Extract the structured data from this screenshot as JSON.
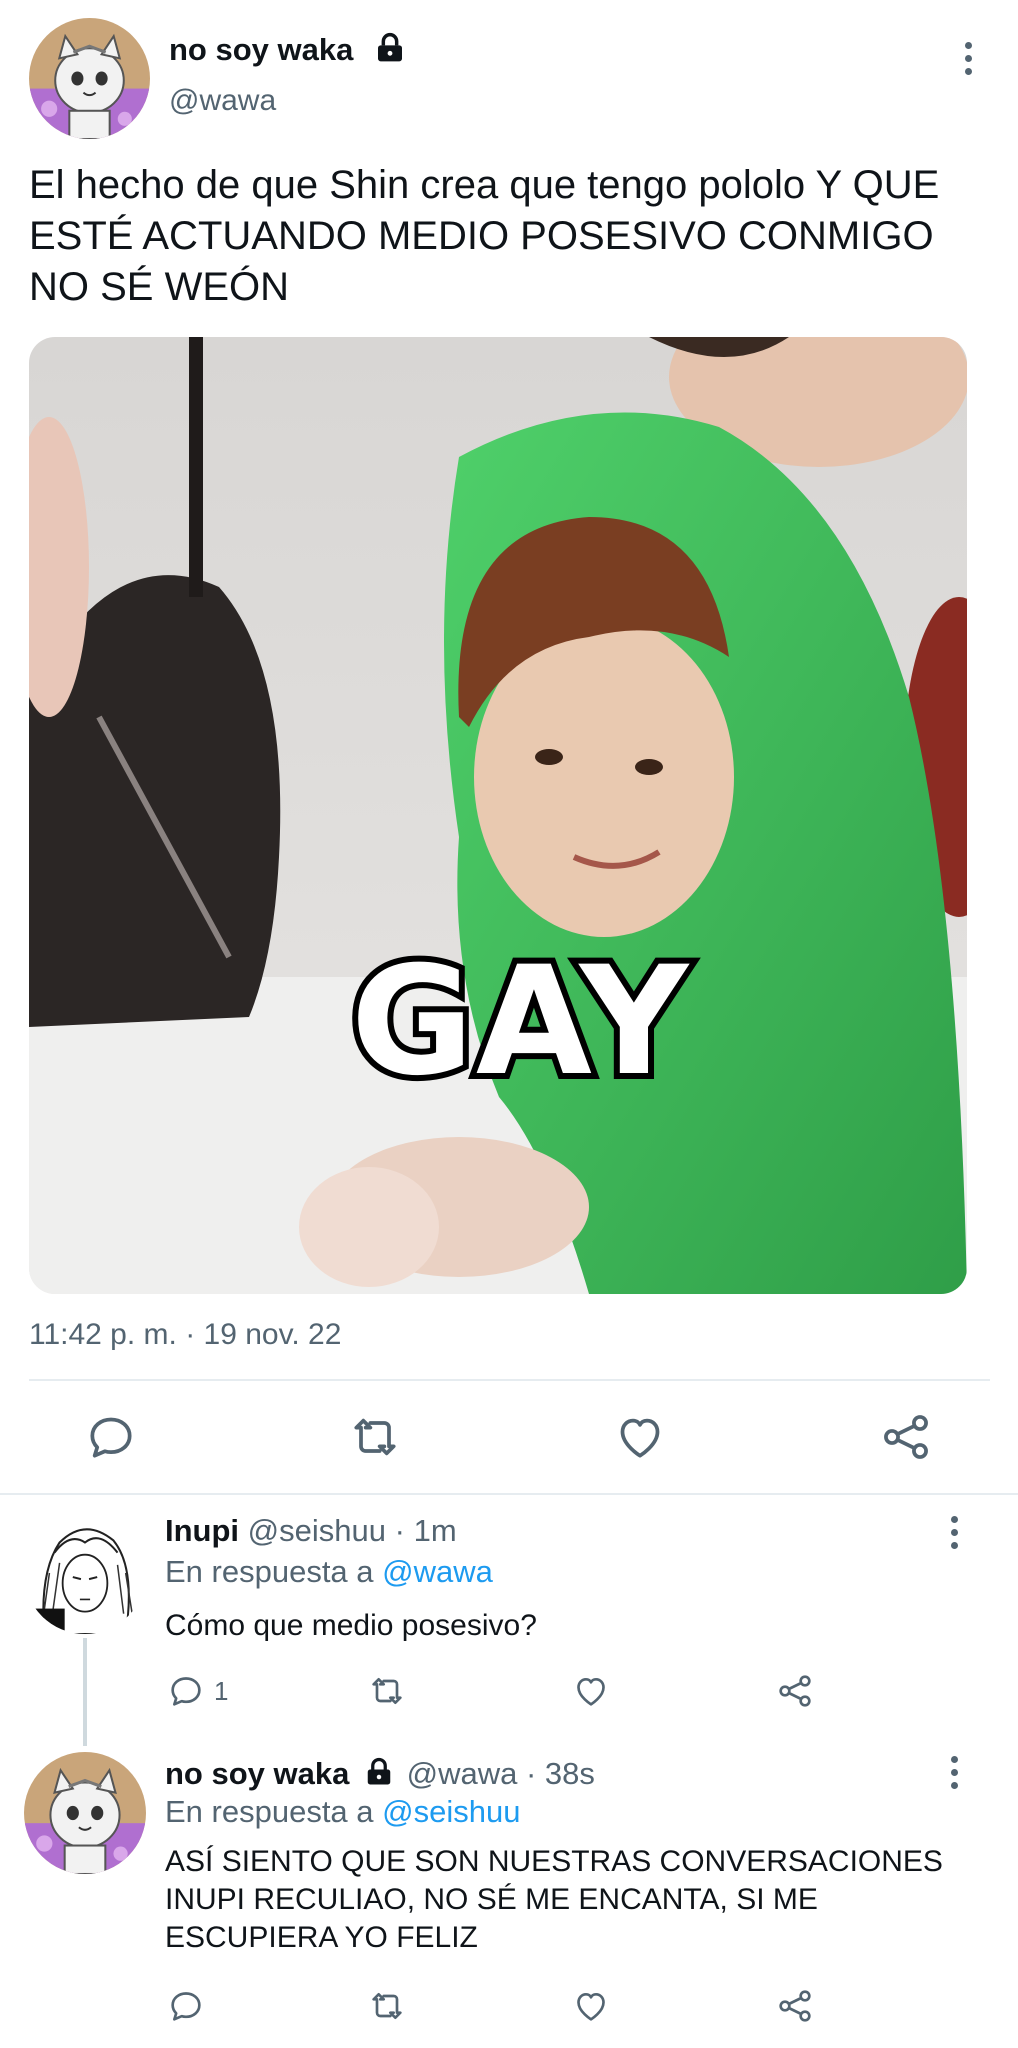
{
  "main_tweet": {
    "display_name": "no soy waka",
    "handle": "@wawa",
    "text": "El hecho de que Shin crea que tengo pololo Y QUE ESTÉ ACTUANDO MEDIO POSESIVO CONMIGO NO SÉ WEÓN",
    "media_caption": "GAY",
    "timestamp": "11:42 p. m. · 19 nov. 22",
    "icons": {
      "lock": "lock-icon",
      "more": "more-vertical-icon"
    }
  },
  "action_bar": {
    "icons": [
      "reply-icon",
      "retweet-icon",
      "like-icon",
      "share-icon"
    ]
  },
  "replies": [
    {
      "display_name": "Inupi",
      "handle": "@seishuu",
      "separator": "·",
      "time": "1m",
      "reply_to_prefix": "En respuesta a",
      "reply_to_mention": "@wawa",
      "text": "Cómo que medio posesivo?",
      "reply_count": "1"
    },
    {
      "display_name": "no soy waka",
      "handle": "@wawa",
      "separator": "·",
      "time": "38s",
      "reply_to_prefix": "En respuesta a",
      "reply_to_mention": "@seishuu",
      "text": "ASÍ SIENTO QUE SON NUESTRAS CONVERSACIONES INUPI RECULIAO, NO SÉ ME ENCANTA, SI ME ESCUPIERA YO FELIZ",
      "reply_count": ""
    }
  ],
  "colors": {
    "text_primary": "#0f1419",
    "text_secondary": "#536471",
    "mention": "#1d9bf0",
    "divider": "#e6ecf0",
    "hoodie_green": "#3fbf5a"
  }
}
